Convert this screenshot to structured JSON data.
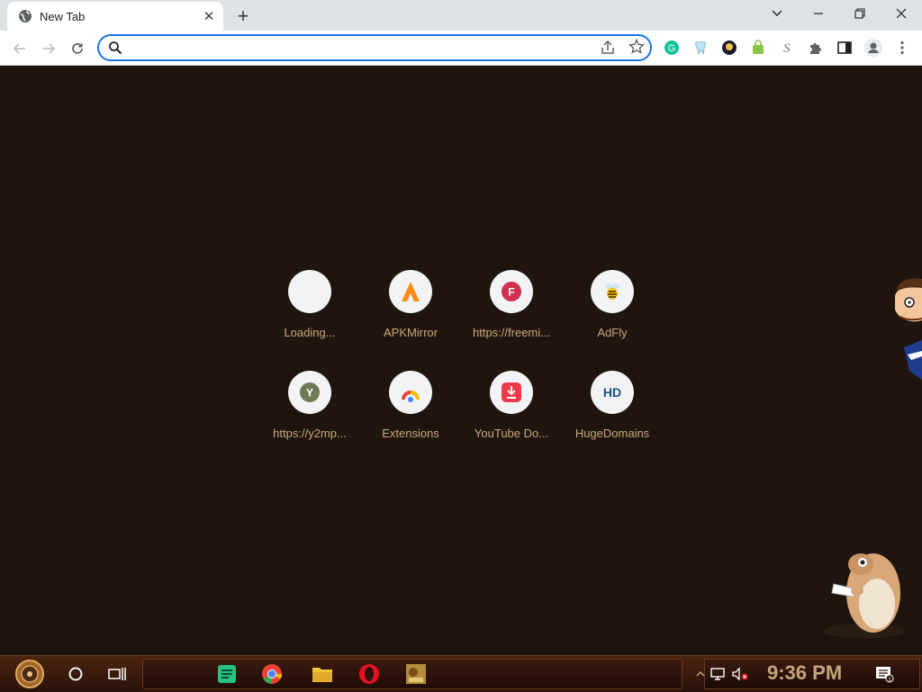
{
  "tab": {
    "title": "New Tab"
  },
  "omnibox": {
    "value": "",
    "placeholder": ""
  },
  "shortcuts": [
    {
      "label": "Loading...",
      "icon": "blank-icon"
    },
    {
      "label": "APKMirror",
      "icon": "apkmirror-icon"
    },
    {
      "label": "https://freemi...",
      "icon": "freemi-icon"
    },
    {
      "label": "AdFly",
      "icon": "adfly-icon"
    },
    {
      "label": "https://y2mp...",
      "icon": "y2mp-icon"
    },
    {
      "label": "Extensions",
      "icon": "chrome-extensions-icon"
    },
    {
      "label": "YouTube Do...",
      "icon": "youtube-downloader-icon"
    },
    {
      "label": "HugeDomains",
      "icon": "hugedomains-icon"
    }
  ],
  "taskbar": {
    "clock": "9:36 PM"
  },
  "colors": {
    "background": "#1f150e",
    "label": "#c9a97a",
    "accent": "#1a73e8"
  }
}
